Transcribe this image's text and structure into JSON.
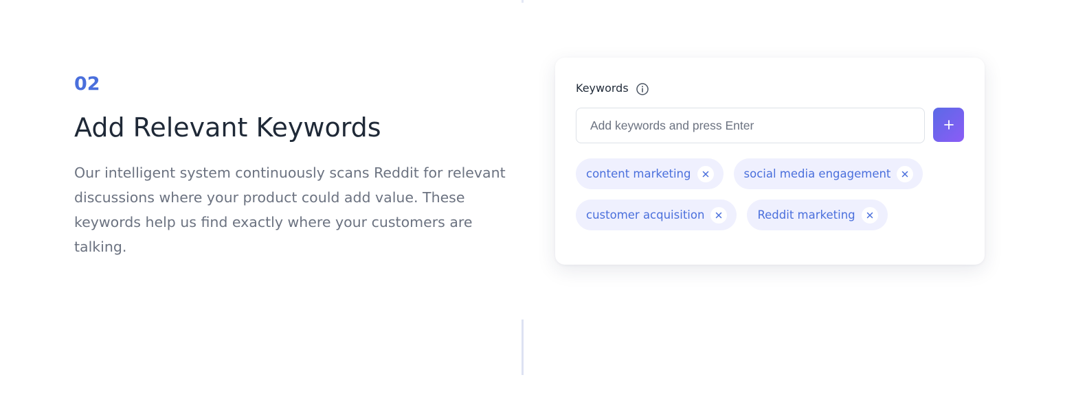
{
  "step": {
    "number": "02",
    "title": "Add Relevant Keywords",
    "description": "Our intelligent system continuously scans Reddit for relevant discussions where your product could add value. These keywords help us find exactly where your customers are talking."
  },
  "keywords_card": {
    "label": "Keywords",
    "info_icon": "info-circle-icon",
    "input_placeholder": "Add keywords and press Enter",
    "input_value": "",
    "add_icon": "plus-icon",
    "remove_icon": "close-icon",
    "chips": [
      {
        "label": "content marketing"
      },
      {
        "label": "social media engagement"
      },
      {
        "label": "customer acquisition"
      },
      {
        "label": "Reddit marketing"
      }
    ]
  },
  "colors": {
    "accent": "#4a6fdc",
    "title": "#1f2937",
    "body_text": "#6b7280",
    "chip_bg": "#eff0fe",
    "button_gradient_start": "#5b6ae6",
    "button_gradient_end": "#8b5cf6"
  }
}
